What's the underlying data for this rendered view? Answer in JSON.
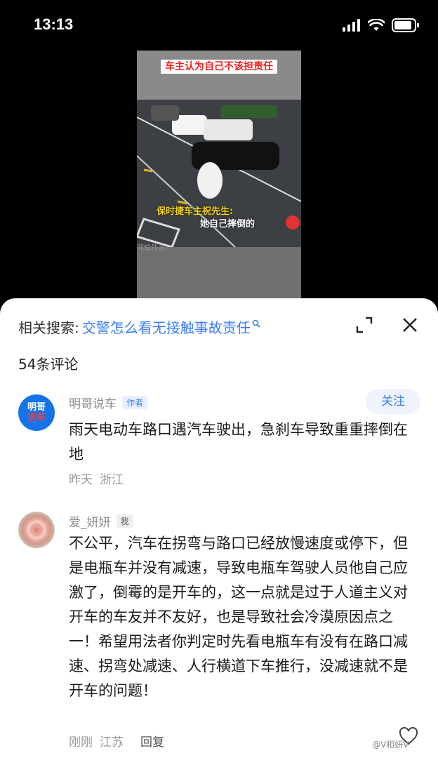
{
  "status": {
    "time": "13:13"
  },
  "video": {
    "top_caption": "车主认为自己不该担责任",
    "subtitle_speaker": "保时捷车主祝先生:",
    "subtitle_line": "她自己摔倒的",
    "watermark": "同检外治"
  },
  "search": {
    "label": "相关搜索:",
    "query": "交警怎么看无接触事故责任",
    "suffix": "Q"
  },
  "comment_count": "54条评论",
  "comments": [
    {
      "avatar_text_1": "明哥",
      "avatar_text_2": "说车",
      "username": "明哥说车",
      "tag": "作者",
      "follow": "关注",
      "text": "雨天电动车路口遇汽车驶出，急刹车导致重重摔倒在地",
      "time": "昨天",
      "location": "浙江"
    },
    {
      "username": "爱_妍妍",
      "tag": "我",
      "text": "不公平，汽车在拐弯与路口已经放慢速度或停下，但是电瓶车并没有减速，导致电瓶车驾驶人员他自己应激了，倒霉的是开车的，这一点就是过于人道主义对开车的车友并不友好，也是导致社会冷漠原因点之一！希望用法者你判定时先看电瓶车有没有在路口减速、拐弯处减速、人行横道下车推行，没减速就不是开车的问题！",
      "time": "刚刚",
      "location": "江苏",
      "reply": "回复"
    }
  ],
  "footer_watermark": "@V相妍V"
}
